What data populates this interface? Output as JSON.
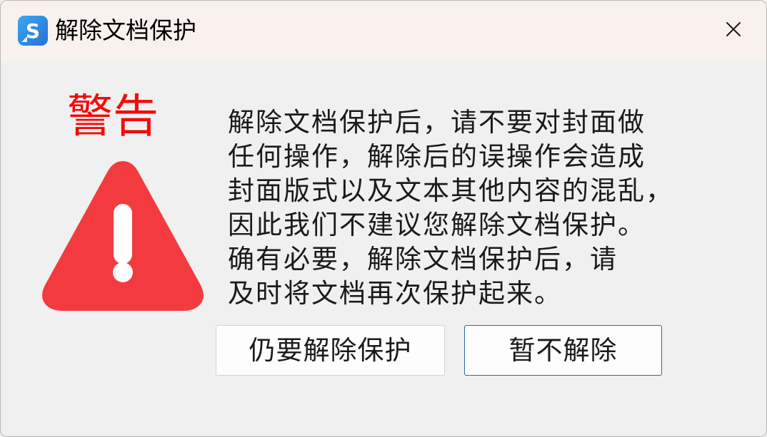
{
  "window": {
    "title": "解除文档保护",
    "app_icon": "s-app-icon",
    "close_icon": "close-icon"
  },
  "warning": {
    "heading": "警告",
    "heading_color": "#f50a0a",
    "icon": "warning-triangle-icon",
    "icon_color": "#f33b3f",
    "message_lines": [
      "解除文档保护后，请不要对封面做",
      "任何操作，解除后的误操作会造成",
      "封面版式以及文本其他内容的混乱，",
      "因此我们不建议您解除文档保护。",
      "确有必要，解除文档保护后，请",
      "及时将文档再次保护起来。"
    ]
  },
  "buttons": {
    "remove_label": "仍要解除保护",
    "cancel_label": "暂不解除"
  }
}
